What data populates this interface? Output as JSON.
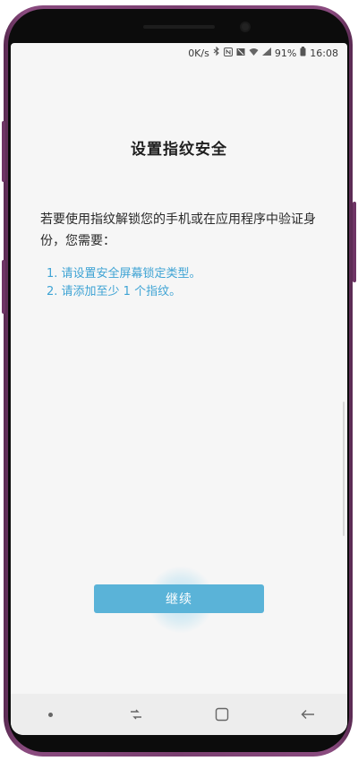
{
  "status_bar": {
    "speed": "0K/s",
    "battery": "91%",
    "time": "16:08"
  },
  "page": {
    "title": "设置指纹安全",
    "description": "若要使用指纹解锁您的手机或在应用程序中验证身份，您需要：",
    "steps": [
      "1. 请设置安全屏幕锁定类型。",
      "2. 请添加至少 1 个指纹。"
    ],
    "continue_label": "继续"
  },
  "colors": {
    "accent": "#5ab3d8",
    "step_text": "#3ea3d4",
    "frame": "#7a3f70"
  },
  "nav_icons": [
    "dot-icon",
    "recent-apps-icon",
    "home-icon",
    "back-icon"
  ]
}
